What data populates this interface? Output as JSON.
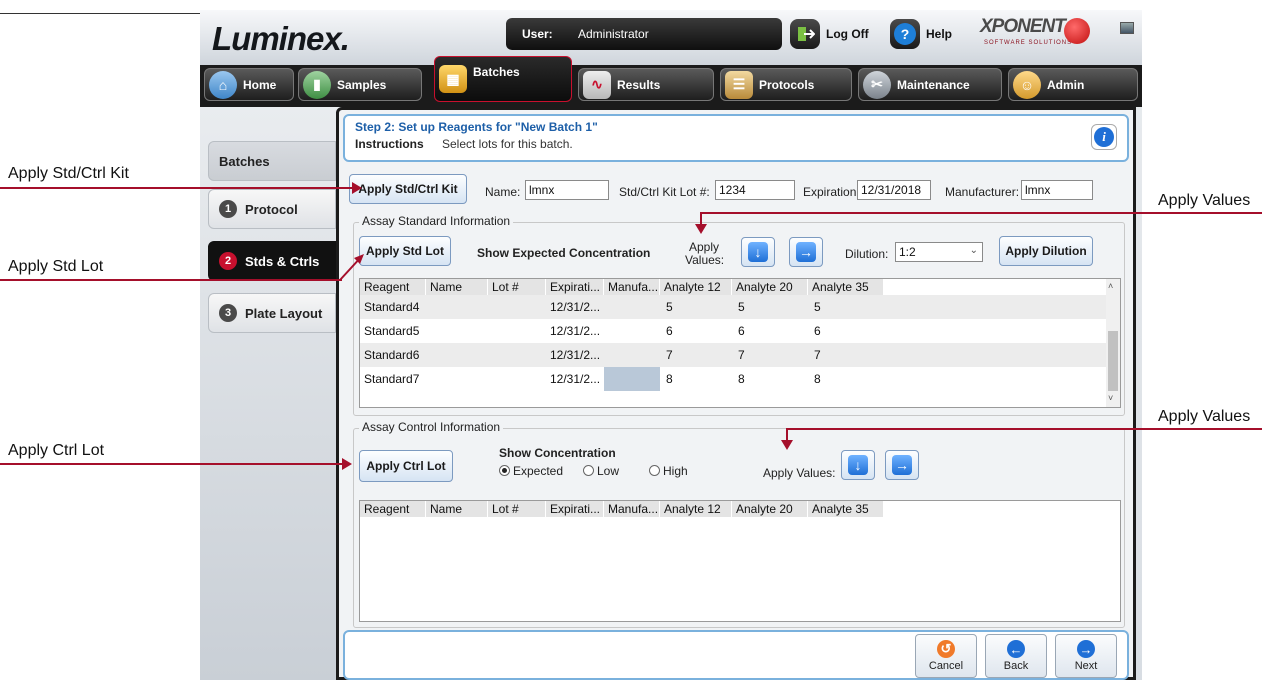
{
  "callouts": {
    "apply_kit": "Apply Std/Ctrl Kit",
    "apply_std_lot": "Apply Std Lot",
    "apply_ctrl_lot": "Apply Ctrl Lot",
    "apply_values_top": "Apply Values",
    "apply_values_bottom": "Apply Values",
    "line_color": "#a50f2b"
  },
  "header": {
    "logo": "Luminex.",
    "user_label": "User:",
    "user_value": "Administrator",
    "logoff": "Log Off",
    "help": "Help",
    "brand": "XPONENT",
    "brand_sub": "SOFTWARE SOLUTIONS"
  },
  "tabs": [
    {
      "label": "Home",
      "icon": "home-icon"
    },
    {
      "label": "Samples",
      "icon": "samples-icon"
    },
    {
      "label": "Batches",
      "icon": "batches-icon"
    },
    {
      "label": "Results",
      "icon": "results-icon"
    },
    {
      "label": "Protocols",
      "icon": "protocols-icon"
    },
    {
      "label": "Maintenance",
      "icon": "maintenance-icon"
    },
    {
      "label": "Admin",
      "icon": "admin-icon"
    }
  ],
  "sidebar": {
    "title": "Batches",
    "items": [
      {
        "num": "1",
        "label": "Protocol"
      },
      {
        "num": "2",
        "label": "Stds & Ctrls"
      },
      {
        "num": "3",
        "label": "Plate Layout"
      }
    ]
  },
  "step": {
    "title": "Step 2: Set up Reagents for \"New Batch 1\"",
    "instructions_label": "Instructions",
    "instructions_text": "Select lots for this batch."
  },
  "kit": {
    "button": "Apply Std/Ctrl Kit",
    "name_label": "Name:",
    "name_value": "lmnx",
    "lot_label": "Std/Ctrl Kit Lot #:",
    "lot_value": "1234",
    "exp_label": "Expiration:",
    "exp_value": "12/31/2018",
    "mfr_label": "Manufacturer:",
    "mfr_value": "lmnx"
  },
  "standard": {
    "group_title": "Assay Standard Information",
    "apply_lot": "Apply Std Lot",
    "show_expected": "Show Expected Concentration",
    "apply_values_1": "Apply",
    "apply_values_2": "Values:",
    "dilution_label": "Dilution:",
    "dilution_value": "1:2",
    "apply_dilution": "Apply Dilution",
    "columns": [
      "Reagent",
      "Name",
      "Lot #",
      "Expirati...",
      "Manufa...",
      "Analyte 12",
      "Analyte 20",
      "Analyte 35"
    ],
    "rows": [
      [
        "Standard4",
        "",
        "",
        "12/31/2...",
        "",
        "5",
        "5",
        "5"
      ],
      [
        "Standard5",
        "",
        "",
        "12/31/2...",
        "",
        "6",
        "6",
        "6"
      ],
      [
        "Standard6",
        "",
        "",
        "12/31/2...",
        "",
        "7",
        "7",
        "7"
      ],
      [
        "Standard7",
        "",
        "",
        "12/31/2...",
        "",
        "8",
        "8",
        "8"
      ]
    ]
  },
  "control": {
    "group_title": "Assay Control Information",
    "apply_lot": "Apply Ctrl Lot",
    "show_conc": "Show Concentration",
    "opt_expected": "Expected",
    "opt_low": "Low",
    "opt_high": "High",
    "apply_values": "Apply Values:",
    "columns": [
      "Reagent",
      "Name",
      "Lot #",
      "Expirati...",
      "Manufa...",
      "Analyte 12",
      "Analyte 20",
      "Analyte 35"
    ]
  },
  "footer": {
    "cancel": "Cancel",
    "back": "Back",
    "next": "Next"
  }
}
